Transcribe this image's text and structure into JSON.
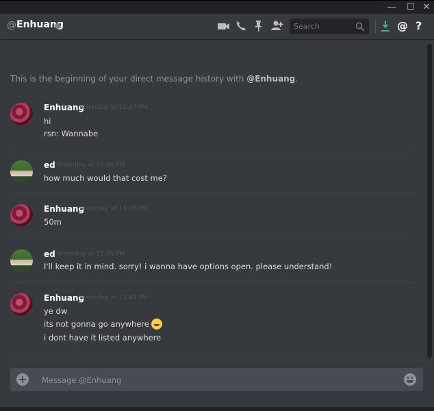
{
  "window": {
    "minimize_glyph": "—",
    "maximize_glyph": "☐",
    "close_glyph": "✕"
  },
  "header": {
    "at_symbol": "@",
    "username": "Enhuang",
    "status": "offline",
    "search_placeholder": "Search",
    "icons": [
      "video-call-icon",
      "voice-call-icon",
      "pin-icon",
      "add-friend-icon",
      "download-icon",
      "mention-icon",
      "help-icon"
    ],
    "mention_glyph": "@",
    "help_glyph": "?"
  },
  "intro": {
    "prefix": "This is the beginning of your direct message history with ",
    "handle": "@Enhuang",
    "suffix": "."
  },
  "messages": [
    {
      "author": "Enhuang",
      "timestamp": "Yesterday at 11:47 PM",
      "avatar": "flower-avatar",
      "lines": [
        "hi",
        "rsn: Wannabe"
      ]
    },
    {
      "author": "ed",
      "timestamp": "Yesterday at 11:48 PM",
      "avatar": "person-avatar",
      "lines": [
        "how much would that cost me?"
      ]
    },
    {
      "author": "Enhuang",
      "timestamp": "Yesterday at 11:48 PM",
      "avatar": "flower-avatar",
      "lines": [
        "50m"
      ]
    },
    {
      "author": "ed",
      "timestamp": "Yesterday at 11:49 PM",
      "avatar": "person-avatar",
      "lines": [
        "I'll keep it in mind. sorry! i wanna have options open. please understand!"
      ]
    },
    {
      "author": "Enhuang",
      "timestamp": "Yesterday at 11:49 PM",
      "avatar": "flower-avatar",
      "lines": [
        "ye dw",
        "its not gonna go anywhere",
        "i dont have it listed anywhere"
      ],
      "emoji_after_line": 1,
      "emoji": "grinning-face-icon"
    }
  ],
  "composer": {
    "placeholder": "Message @Enhuang"
  },
  "colors": {
    "background": "#36393e",
    "header_bg": "#36393e",
    "titlebar_bg": "#202225",
    "input_bg": "#484b51",
    "text": "#dcddde",
    "muted": "#8e9297",
    "download_accent": "#43b581"
  }
}
